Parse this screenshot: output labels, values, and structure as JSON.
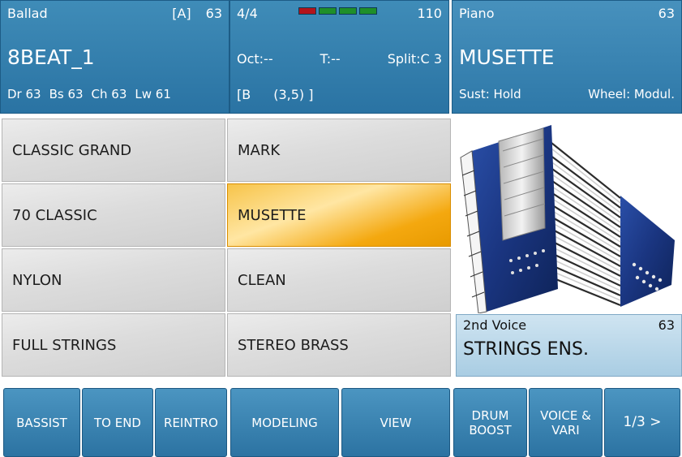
{
  "style_panel": {
    "style_name": "Ballad",
    "variation": "[A]",
    "volume": "63",
    "pattern_name": "8BEAT_1",
    "volumes": [
      "Dr 63",
      "Bs 63",
      "Ch 63",
      "Lw 61"
    ]
  },
  "status_panel": {
    "time_signature": "4/4",
    "tempo": "110",
    "octave": "Oct:--",
    "transpose": "T:--",
    "split": "Split:C 3",
    "chord_bracket": "[B",
    "chord_value": "(3,5) ]",
    "beat_indicators": [
      "#b3141b",
      "#1f8f2a",
      "#1f8f2a",
      "#1f8f2a"
    ]
  },
  "voice_panel": {
    "category": "Piano",
    "volume": "63",
    "voice_name": "MUSETTE",
    "sustain": "Sust: Hold",
    "wheel": "Wheel: Modul."
  },
  "voice_list": [
    {
      "label": "CLASSIC GRAND",
      "selected": false
    },
    {
      "label": "MARK",
      "selected": false
    },
    {
      "label": "70 CLASSIC",
      "selected": false
    },
    {
      "label": "MUSETTE",
      "selected": true
    },
    {
      "label": "NYLON",
      "selected": false
    },
    {
      "label": "CLEAN",
      "selected": false
    },
    {
      "label": "FULL STRINGS",
      "selected": false
    },
    {
      "label": "STEREO BRASS",
      "selected": false
    }
  ],
  "second_voice": {
    "label": "2nd Voice",
    "volume": "63",
    "name": "STRINGS ENS."
  },
  "buttons": {
    "bassist": "BASSIST",
    "to_end": "TO END",
    "reintro": "REINTRO",
    "modeling": "MODELING",
    "view": "VIEW",
    "drum_boost_1": "DRUM",
    "drum_boost_2": "BOOST",
    "voice_vari_1": "VOICE &",
    "voice_vari_2": "VARI",
    "page": "1/3 >"
  },
  "colors": {
    "panel_blue": "#2a73a3",
    "selected_orange": "#f4a80f",
    "second_voice_bg": "#a9cde3"
  },
  "image": {
    "icon": "accordion-icon"
  }
}
